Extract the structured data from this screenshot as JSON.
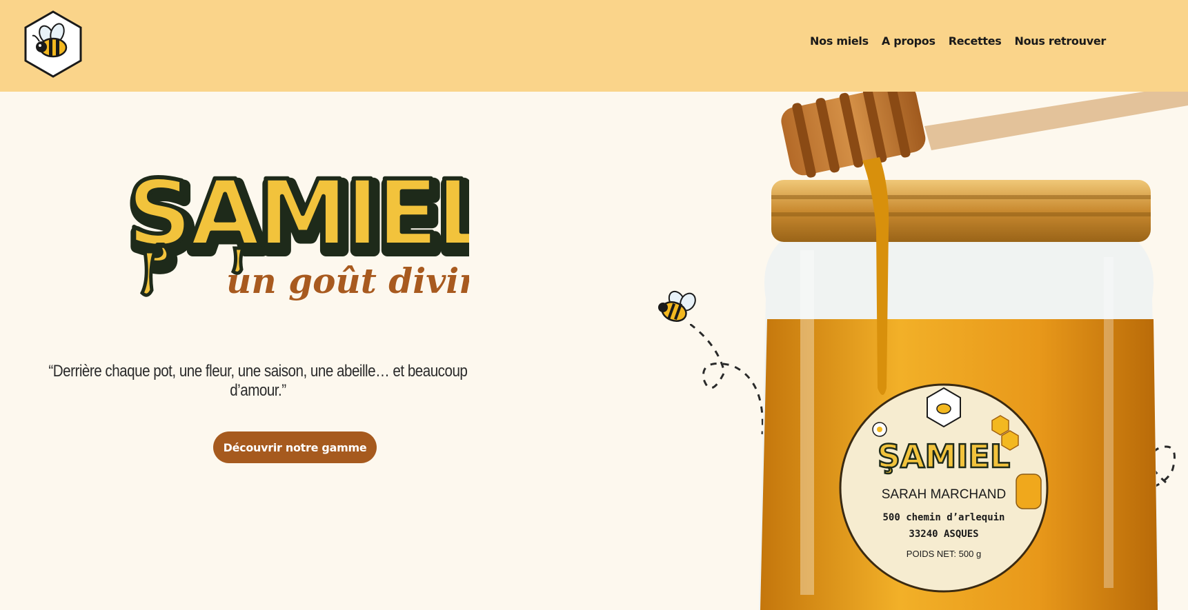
{
  "header": {
    "logo_icon": "bee-hexagon-logo-icon",
    "nav": [
      {
        "label": "Nos miels"
      },
      {
        "label": "A propos"
      },
      {
        "label": "Recettes"
      },
      {
        "label": "Nous retrouver"
      }
    ]
  },
  "hero": {
    "brand": "ŞAMIEL",
    "tagline": "un goût divin",
    "quote": "“Derrière chaque pot, une fleur, une saison, une abeille… et beaucoup d’amour.”",
    "cta_label": "Découvrir notre gamme"
  },
  "jar_label": {
    "brand": "ŞAMIEL",
    "name": "SARAH MARCHAND",
    "address": "500 chemin d’arlequin",
    "city": "33240 ASQUES",
    "weight": "POIDS NET: 500 g"
  },
  "colors": {
    "header_bg": "#fad48a",
    "page_bg": "#fdf8ee",
    "cta_bg": "#a65a1e",
    "honey": "#e8a21a",
    "brand_yellow": "#f2c33c",
    "tagline_brown": "#a85a1f"
  }
}
